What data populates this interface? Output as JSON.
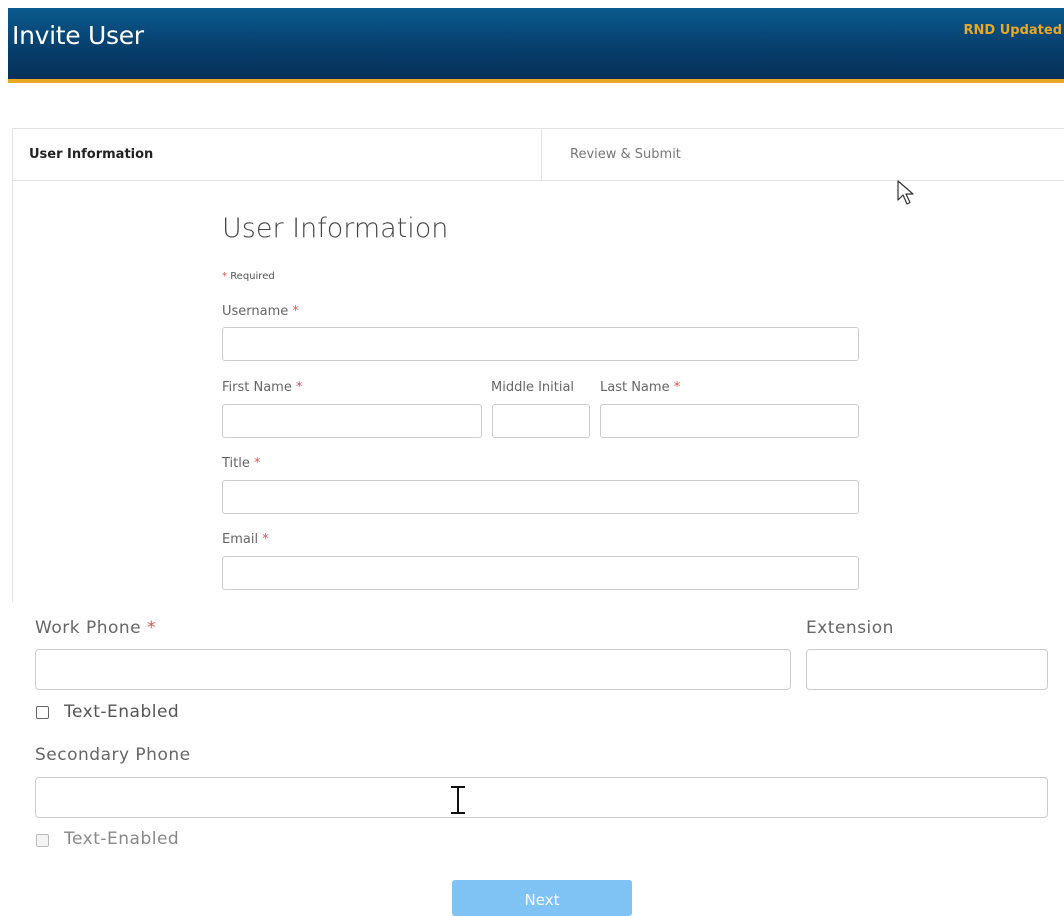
{
  "header": {
    "title": "Invite User",
    "environment": "RND Updated",
    "colors": {
      "bar": "#063e6b",
      "accent": "#e8a823"
    }
  },
  "tabs": [
    {
      "label": "User Information",
      "active": true
    },
    {
      "label": "Review & Submit",
      "active": false
    }
  ],
  "form": {
    "title": "User Information",
    "required_note": "Required",
    "required_marker": "*",
    "fields": {
      "username": {
        "label": "Username",
        "value": ""
      },
      "first_name": {
        "label": "First Name",
        "value": ""
      },
      "middle_initial": {
        "label": "Middle Initial",
        "value": ""
      },
      "last_name": {
        "label": "Last Name",
        "value": ""
      },
      "title": {
        "label": "Title",
        "value": ""
      },
      "email": {
        "label": "Email",
        "value": ""
      },
      "work_phone": {
        "label": "Work Phone",
        "value": ""
      },
      "extension": {
        "label": "Extension",
        "value": ""
      },
      "work_text_enabled": {
        "label": "Text-Enabled",
        "checked": false
      },
      "secondary_phone": {
        "label": "Secondary Phone",
        "value": ""
      },
      "secondary_text_enabled": {
        "label": "Text-Enabled",
        "checked": false,
        "disabled": true
      }
    },
    "next_button": "Next"
  },
  "icons": [
    "mouse-pointer-icon",
    "text-cursor-icon"
  ]
}
